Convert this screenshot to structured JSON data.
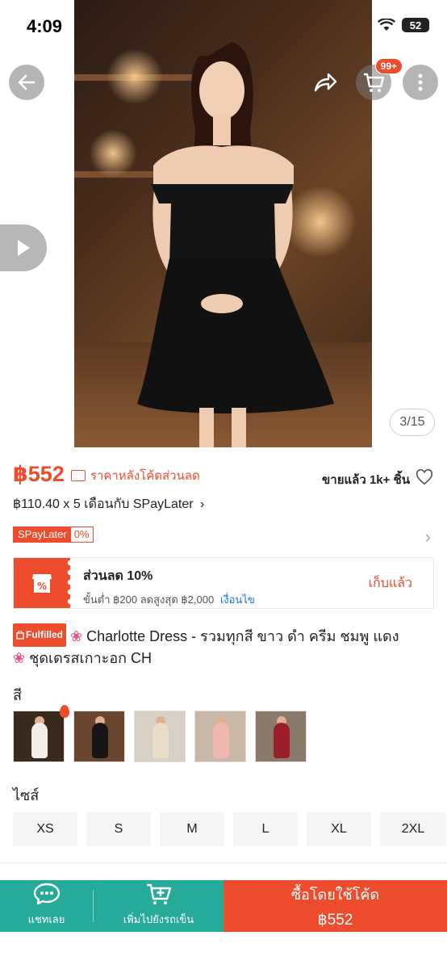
{
  "status_bar": {
    "time": "4:09",
    "battery": "52"
  },
  "gallery": {
    "counter": "3/15",
    "cart_badge": "99+"
  },
  "price": {
    "amount": "฿552",
    "note": "ราคาหลังโค้ดส่วนลด",
    "sold": "ขายแล้ว 1k+ ชิ้น",
    "installment": "฿110.40 x 5 เดือนกับ SPayLater",
    "spaylater_label": "SPayLater",
    "spaylater_rate": "0%"
  },
  "voucher": {
    "title": "ส่วนลด 10%",
    "subtitle": "ขั้นต่ำ ฿200 ลดสูงสุด ฿2,000",
    "conditions_link": "เงื่อนไข",
    "claim_label": "เก็บแล้ว"
  },
  "product": {
    "badge": "Fulfilled",
    "title_line1": "Charlotte Dress - รวมทุกสี ขาว ดำ ครีม ชมพู แดง",
    "title_line2": "ชุดเดรสเกาะอก CH"
  },
  "color_section": {
    "label": "สี",
    "options": [
      {
        "name": "white",
        "dress": "#f2ede6",
        "bg": "#3a2a1c"
      },
      {
        "name": "black",
        "dress": "#161616",
        "bg": "#6a4630"
      },
      {
        "name": "cream",
        "dress": "#e9dcc8",
        "bg": "#d8d0c4"
      },
      {
        "name": "pink",
        "dress": "#f0b8b0",
        "bg": "#c9b8a8"
      },
      {
        "name": "red",
        "dress": "#9a1e2a",
        "bg": "#8a7a6a"
      }
    ]
  },
  "size_section": {
    "label": "ไซส์",
    "options": [
      "XS",
      "S",
      "M",
      "L",
      "XL",
      "2XL"
    ]
  },
  "bottom_bar": {
    "chat_label": "แชทเลย",
    "add_cart_label": "เพิ่มไปยังรถเข็น",
    "buy_label": "ซื้อโดยใช้โค้ด",
    "buy_price": "฿552"
  },
  "colors": {
    "accent": "#ee4d2d",
    "teal": "#26aa99"
  }
}
